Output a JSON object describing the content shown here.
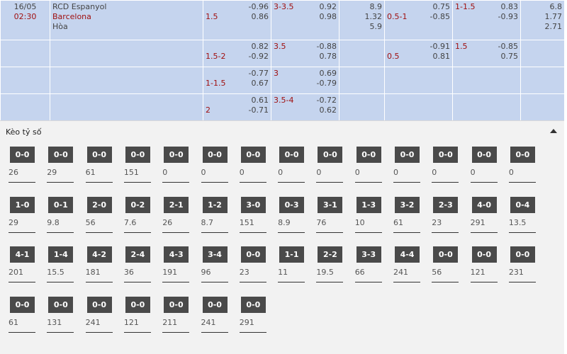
{
  "match": {
    "date": "16/05",
    "time": "02:30",
    "home": "RCD Espanyol",
    "away": "Barcelona",
    "draw": "Hòa"
  },
  "rows": [
    {
      "h1_line": "1.5",
      "h1_home": "-0.96",
      "h1_away": "0.86",
      "ou_line": "3-3.5",
      "ou_over": "0.92",
      "ou_under": "0.98",
      "x12": [
        "8.9",
        "1.32",
        "5.9"
      ],
      "fh_line": "0.5-1",
      "fh_home": "0.75",
      "fh_away": "-0.85",
      "fhou_line": "1-1.5",
      "fhou_over": "0.83",
      "fhou_under": "-0.93",
      "fhx12": [
        "6.8",
        "1.77",
        "2.71"
      ]
    },
    {
      "h1_line": "1.5-2",
      "h1_home": "0.82",
      "h1_away": "-0.92",
      "ou_line": "3.5",
      "ou_over": "-0.88",
      "ou_under": "0.78",
      "fh_line": "0.5",
      "fh_home": "-0.91",
      "fh_away": "0.81",
      "fhou_line": "1.5",
      "fhou_over": "-0.85",
      "fhou_under": "0.75"
    },
    {
      "h1_line": "1-1.5",
      "h1_home": "-0.77",
      "h1_away": "0.67",
      "ou_line": "3",
      "ou_over": "0.69",
      "ou_under": "-0.79"
    },
    {
      "h1_line": "2",
      "h1_home": "0.61",
      "h1_away": "-0.71",
      "ou_line": "3.5-4",
      "ou_over": "-0.72",
      "ou_under": "0.62"
    }
  ],
  "score_section": {
    "title": "Kèo tỷ số",
    "icon": "triangle-up-icon",
    "rows": [
      [
        {
          "score": "0-0",
          "odds": "26"
        },
        {
          "score": "0-0",
          "odds": "29"
        },
        {
          "score": "0-0",
          "odds": "61"
        },
        {
          "score": "0-0",
          "odds": "151"
        },
        {
          "score": "0-0",
          "odds": "0"
        },
        {
          "score": "0-0",
          "odds": "0"
        },
        {
          "score": "0-0",
          "odds": "0"
        },
        {
          "score": "0-0",
          "odds": "0"
        },
        {
          "score": "0-0",
          "odds": "0"
        },
        {
          "score": "0-0",
          "odds": "0"
        },
        {
          "score": "0-0",
          "odds": "0"
        },
        {
          "score": "0-0",
          "odds": "0"
        },
        {
          "score": "0-0",
          "odds": "0"
        },
        {
          "score": "0-0",
          "odds": "0"
        }
      ],
      [
        {
          "score": "1-0",
          "odds": "29"
        },
        {
          "score": "0-1",
          "odds": "9.8"
        },
        {
          "score": "2-0",
          "odds": "56"
        },
        {
          "score": "0-2",
          "odds": "7.6"
        },
        {
          "score": "2-1",
          "odds": "26"
        },
        {
          "score": "1-2",
          "odds": "8.7"
        },
        {
          "score": "3-0",
          "odds": "151"
        },
        {
          "score": "0-3",
          "odds": "8.9"
        },
        {
          "score": "3-1",
          "odds": "76"
        },
        {
          "score": "1-3",
          "odds": "10"
        },
        {
          "score": "3-2",
          "odds": "61"
        },
        {
          "score": "2-3",
          "odds": "23"
        },
        {
          "score": "4-0",
          "odds": "291"
        },
        {
          "score": "0-4",
          "odds": "13.5"
        }
      ],
      [
        {
          "score": "4-1",
          "odds": "201"
        },
        {
          "score": "1-4",
          "odds": "15.5"
        },
        {
          "score": "4-2",
          "odds": "181"
        },
        {
          "score": "2-4",
          "odds": "36"
        },
        {
          "score": "4-3",
          "odds": "191"
        },
        {
          "score": "3-4",
          "odds": "96"
        },
        {
          "score": "0-0",
          "odds": "23"
        },
        {
          "score": "1-1",
          "odds": "11"
        },
        {
          "score": "2-2",
          "odds": "19.5"
        },
        {
          "score": "3-3",
          "odds": "66"
        },
        {
          "score": "4-4",
          "odds": "241"
        },
        {
          "score": "0-0",
          "odds": "56"
        },
        {
          "score": "0-0",
          "odds": "121"
        },
        {
          "score": "0-0",
          "odds": "231"
        }
      ],
      [
        {
          "score": "0-0",
          "odds": "61"
        },
        {
          "score": "0-0",
          "odds": "131"
        },
        {
          "score": "0-0",
          "odds": "241"
        },
        {
          "score": "0-0",
          "odds": "121"
        },
        {
          "score": "0-0",
          "odds": "211"
        },
        {
          "score": "0-0",
          "odds": "241"
        },
        {
          "score": "0-0",
          "odds": "291"
        }
      ]
    ]
  }
}
